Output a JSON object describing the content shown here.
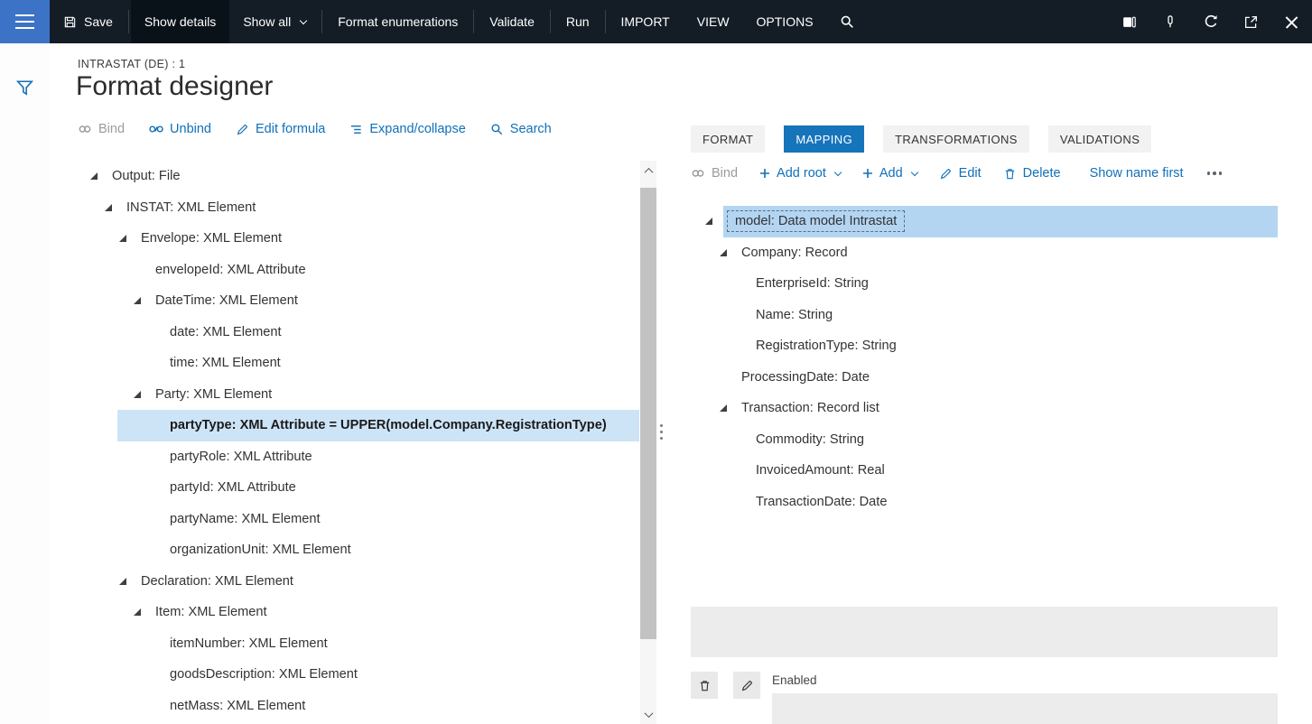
{
  "topbar": {
    "save": "Save",
    "show_details": "Show details",
    "show_all": "Show all",
    "format_enumerations": "Format enumerations",
    "validate": "Validate",
    "run": "Run",
    "import": "IMPORT",
    "view": "VIEW",
    "options": "OPTIONS"
  },
  "page": {
    "record_caption": "INTRASTAT (DE) : 1",
    "title": "Format designer"
  },
  "designer_toolbar": {
    "bind": "Bind",
    "unbind": "Unbind",
    "edit_formula": "Edit formula",
    "expand_collapse": "Expand/collapse",
    "search": "Search"
  },
  "format_tree": {
    "rows": [
      {
        "label": "Output: File"
      },
      {
        "label": "INSTAT: XML Element"
      },
      {
        "label": "Envelope: XML Element"
      },
      {
        "label": "envelopeId: XML Attribute"
      },
      {
        "label": "DateTime: XML Element"
      },
      {
        "label": "date: XML Element"
      },
      {
        "label": "time: XML Element"
      },
      {
        "label": "Party: XML Element"
      },
      {
        "label": "partyType: XML Attribute = UPPER(model.Company.RegistrationType)"
      },
      {
        "label": "partyRole: XML Attribute"
      },
      {
        "label": "partyId: XML Attribute"
      },
      {
        "label": "partyName: XML Element"
      },
      {
        "label": "organizationUnit: XML Element"
      },
      {
        "label": "Declaration: XML Element"
      },
      {
        "label": "Item: XML Element"
      },
      {
        "label": "itemNumber: XML Element"
      },
      {
        "label": "goodsDescription: XML Element"
      },
      {
        "label": "netMass: XML Element"
      }
    ]
  },
  "mapping_panel": {
    "tabs": [
      {
        "label": "FORMAT"
      },
      {
        "label": "MAPPING"
      },
      {
        "label": "TRANSFORMATIONS"
      },
      {
        "label": "VALIDATIONS"
      }
    ],
    "toolbar": {
      "bind": "Bind",
      "add_root": "Add root",
      "add": "Add",
      "edit": "Edit",
      "delete": "Delete",
      "show_name_first": "Show name first"
    },
    "tree": {
      "rows": [
        {
          "label": "model: Data model Intrastat"
        },
        {
          "label": "Company: Record"
        },
        {
          "label": "EnterpriseId: String"
        },
        {
          "label": "Name: String"
        },
        {
          "label": "RegistrationType: String"
        },
        {
          "label": "ProcessingDate: Date"
        },
        {
          "label": "Transaction: Record list"
        },
        {
          "label": "Commodity: String"
        },
        {
          "label": "InvoicedAmount: Real"
        },
        {
          "label": "TransactionDate: Date"
        }
      ]
    },
    "enabled_label": "Enabled"
  },
  "colors": {
    "topbar_bg": "#141d26",
    "hamburger_bg": "#3c73c6",
    "accent_blue": "#1170b8",
    "active_tab": "#1674bb",
    "selected_row_left": "#cde4f7",
    "selected_row_right": "#b3d5f2"
  }
}
